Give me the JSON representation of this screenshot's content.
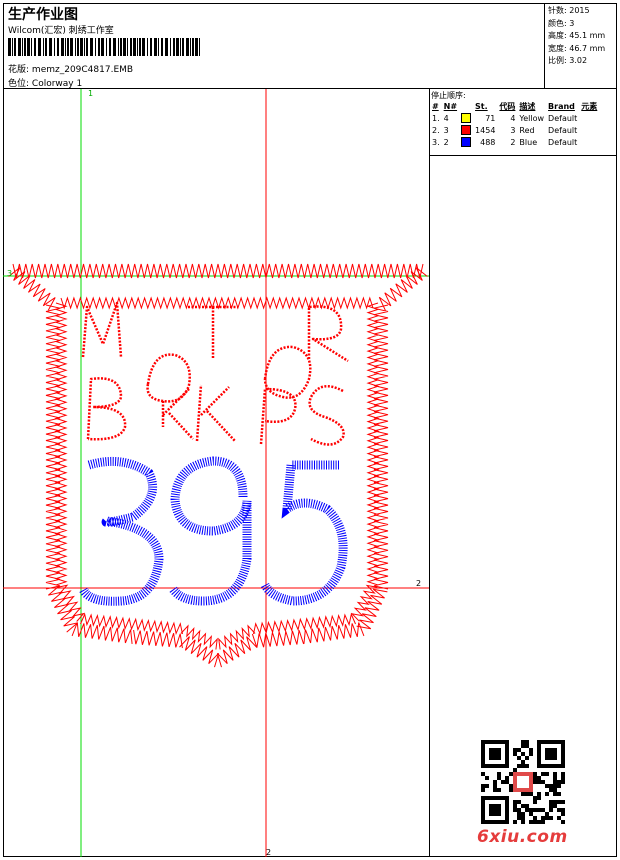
{
  "header": {
    "title": "生产作业图",
    "subtitle": "Wilcom(汇宏) 刺绣工作室",
    "file_label": "花版:",
    "file_name": "memz_209C4817.EMB",
    "colorway_label": "色位:",
    "colorway_name": "Colorway 1"
  },
  "stats": {
    "stitches_label": "针数:",
    "stitches": "2015",
    "colors_label": "颜色:",
    "colors": "3",
    "height_label": "高度:",
    "height": "45.1 mm",
    "width_label": "宽度:",
    "width": "46.7 mm",
    "ratio_label": "比例:",
    "ratio": "3.02"
  },
  "stop_sequence": {
    "title": "停止顺序:",
    "columns": [
      "#",
      "N#",
      "St.",
      "代码",
      "描述",
      "Brand",
      "元素"
    ],
    "rows": [
      {
        "idx": "1.",
        "n": "4",
        "color": "#ffff00",
        "st": "71",
        "code": "4",
        "desc": "Yellow",
        "brand": "Default"
      },
      {
        "idx": "2.",
        "n": "3",
        "color": "#ff0000",
        "st": "1454",
        "code": "3",
        "desc": "Red",
        "brand": "Default"
      },
      {
        "idx": "3.",
        "n": "2",
        "color": "#0000ff",
        "st": "488",
        "code": "2",
        "desc": "Blue",
        "brand": "Default"
      }
    ]
  },
  "design": {
    "line1": "MTR",
    "line2": "BKKPS",
    "number": "395"
  },
  "axis_labels": {
    "v1_top": "1",
    "v2_bottom": "2",
    "h2_right": "2",
    "h3_left": "3"
  },
  "watermark": "6xiu.com",
  "colors": {
    "red": "#ff0000",
    "blue": "#0000ff",
    "green": "#00dd00",
    "yellow": "#ffff00"
  }
}
